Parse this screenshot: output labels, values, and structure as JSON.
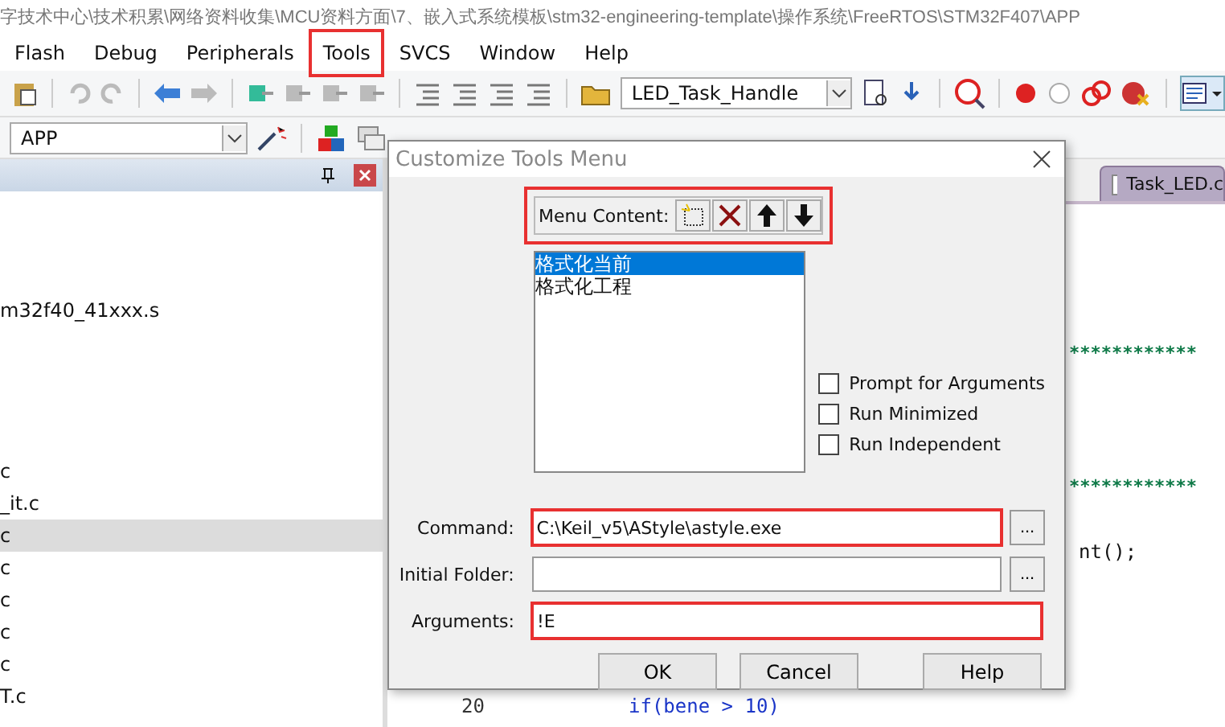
{
  "window": {
    "title": "字技术中心\\技术积累\\网络资料收集\\MCU资料方面\\7、嵌入式系统模板\\stm32-engineering-template\\操作系统\\FreeRTOS\\STM32F407\\APP"
  },
  "menu": [
    {
      "label": "Flash",
      "highlighted": false
    },
    {
      "label": "Debug",
      "highlighted": false
    },
    {
      "label": "Peripherals",
      "highlighted": false
    },
    {
      "label": "Tools",
      "highlighted": true
    },
    {
      "label": "SVCS",
      "highlighted": false
    },
    {
      "label": "Window",
      "highlighted": false
    },
    {
      "label": "Help",
      "highlighted": false
    }
  ],
  "toolbar": {
    "function_combo": "LED_Task_Handle",
    "target_combo": "APP"
  },
  "project_panel": {
    "rows": [
      {
        "text": "m32f40_41xxx.s",
        "selected": false
      },
      {
        "text": "c",
        "selected": false
      },
      {
        "text": "_it.c",
        "selected": false
      },
      {
        "text": "c",
        "selected": true
      },
      {
        "text": "c",
        "selected": false
      },
      {
        "text": "c",
        "selected": false
      },
      {
        "text": "c",
        "selected": false
      },
      {
        "text": "c",
        "selected": false
      },
      {
        "text": "T.c",
        "selected": false
      }
    ]
  },
  "editor": {
    "tab": "Task_LED.c",
    "lines": [
      {
        "text": "************",
        "kind": "comment"
      },
      {
        "text": "************",
        "kind": "comment"
      },
      {
        "text": "nt();",
        "kind": "code"
      },
      {
        "number": "20",
        "text": "if(bene > 10)",
        "kind": "hidden"
      }
    ]
  },
  "dialog": {
    "title": "Customize Tools Menu",
    "menu_content": {
      "label": "Menu Content:",
      "highlighted": true,
      "items": [
        {
          "label": "格式化当前",
          "selected": true
        },
        {
          "label": "格式化工程",
          "selected": false
        }
      ]
    },
    "options": [
      {
        "label": "Prompt for  Arguments",
        "checked": false
      },
      {
        "label": "Run Minimized",
        "checked": false
      },
      {
        "label": "Run Independent",
        "checked": false
      }
    ],
    "fields": [
      {
        "label": "Command:",
        "value": "C:\\Keil_v5\\AStyle\\astyle.exe",
        "browse": "...",
        "highlighted": true
      },
      {
        "label": "Initial Folder:",
        "browse": "...",
        "highlighted": false
      },
      {
        "label": "Arguments:",
        "value": "!E",
        "highlighted": true
      }
    ],
    "buttons": [
      "OK",
      "Cancel",
      "Help"
    ]
  }
}
